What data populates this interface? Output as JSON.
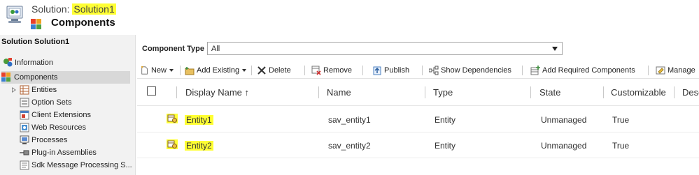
{
  "header": {
    "solution_prefix": "Solution:",
    "solution_name": "Solution1",
    "page_title": "Components"
  },
  "leftnav": {
    "title": "Solution Solution1",
    "items": [
      {
        "label": "Information",
        "icon": "information-icon"
      },
      {
        "label": "Components",
        "icon": "components-icon",
        "selected": true
      },
      {
        "label": "Entities",
        "icon": "entities-icon",
        "expandable": true
      },
      {
        "label": "Option Sets",
        "icon": "option-sets-icon"
      },
      {
        "label": "Client Extensions",
        "icon": "client-extensions-icon"
      },
      {
        "label": "Web Resources",
        "icon": "web-resources-icon"
      },
      {
        "label": "Processes",
        "icon": "processes-icon"
      },
      {
        "label": "Plug-in Assemblies",
        "icon": "plugin-assemblies-icon"
      },
      {
        "label": "Sdk Message Processing S...",
        "icon": "sdk-message-icon"
      }
    ]
  },
  "filter": {
    "label": "Component Type",
    "value": "All"
  },
  "toolbar": {
    "new": "New",
    "add_existing": "Add Existing",
    "delete": "Delete",
    "remove": "Remove",
    "publish": "Publish",
    "show_dependencies": "Show Dependencies",
    "add_required": "Add Required Components",
    "manage": "Manage"
  },
  "grid": {
    "columns": [
      "Display Name ↑",
      "Name",
      "Type",
      "State",
      "Customizable",
      "Desc"
    ],
    "rows": [
      {
        "display_name": "Entity1",
        "name": "sav_entity1",
        "type": "Entity",
        "state": "Unmanaged",
        "customizable": "True"
      },
      {
        "display_name": "Entity2",
        "name": "sav_entity2",
        "type": "Entity",
        "state": "Unmanaged",
        "customizable": "True"
      }
    ]
  },
  "colors": {
    "highlight": "#ffff33",
    "nav_bg": "#f2f2f2",
    "nav_selected": "#d8d8d8"
  }
}
